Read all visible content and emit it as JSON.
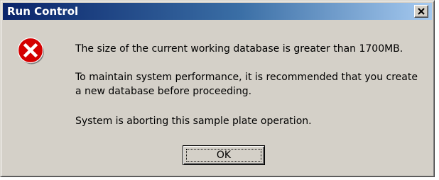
{
  "window": {
    "title": "Run Control",
    "close_icon": "close-icon"
  },
  "dialog": {
    "icon": "error-icon",
    "icon_color": "#d40000",
    "message": {
      "line1": "The size of the current working database is greater than 1700MB.",
      "line2": "To maintain system performance, it is recommended that you create",
      "line3": "a new database before proceeding.",
      "line4": "System is aborting this sample plate operation."
    },
    "ok_label": "OK"
  },
  "colors": {
    "dialog_face": "#d4d0c8",
    "titlebar_start": "#0a246a",
    "titlebar_end": "#a6caf0"
  }
}
